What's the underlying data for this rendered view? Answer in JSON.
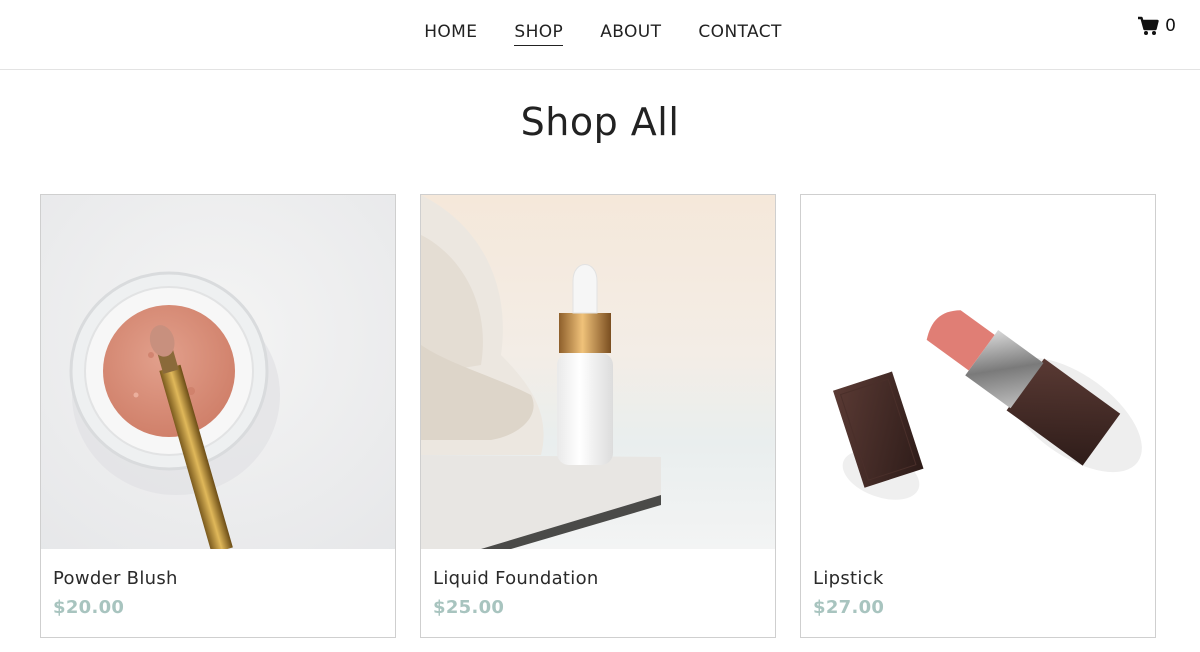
{
  "nav": {
    "items": [
      {
        "label": "HOME",
        "active": false
      },
      {
        "label": "SHOP",
        "active": true
      },
      {
        "label": "ABOUT",
        "active": false
      },
      {
        "label": "CONTACT",
        "active": false
      }
    ]
  },
  "cart": {
    "icon": "shopping-cart-icon",
    "count": "0"
  },
  "page": {
    "title": "Shop All"
  },
  "products": [
    {
      "name": "Powder Blush",
      "price": "$20.00",
      "image": "powder-blush-with-brush"
    },
    {
      "name": "Liquid Foundation",
      "price": "$25.00",
      "image": "dropper-bottle-on-marble"
    },
    {
      "name": "Lipstick",
      "price": "$27.00",
      "image": "lipstick-with-cap"
    }
  ],
  "colors": {
    "price": "#a8c4bf",
    "text": "#222222",
    "border": "#cfcfcf"
  }
}
